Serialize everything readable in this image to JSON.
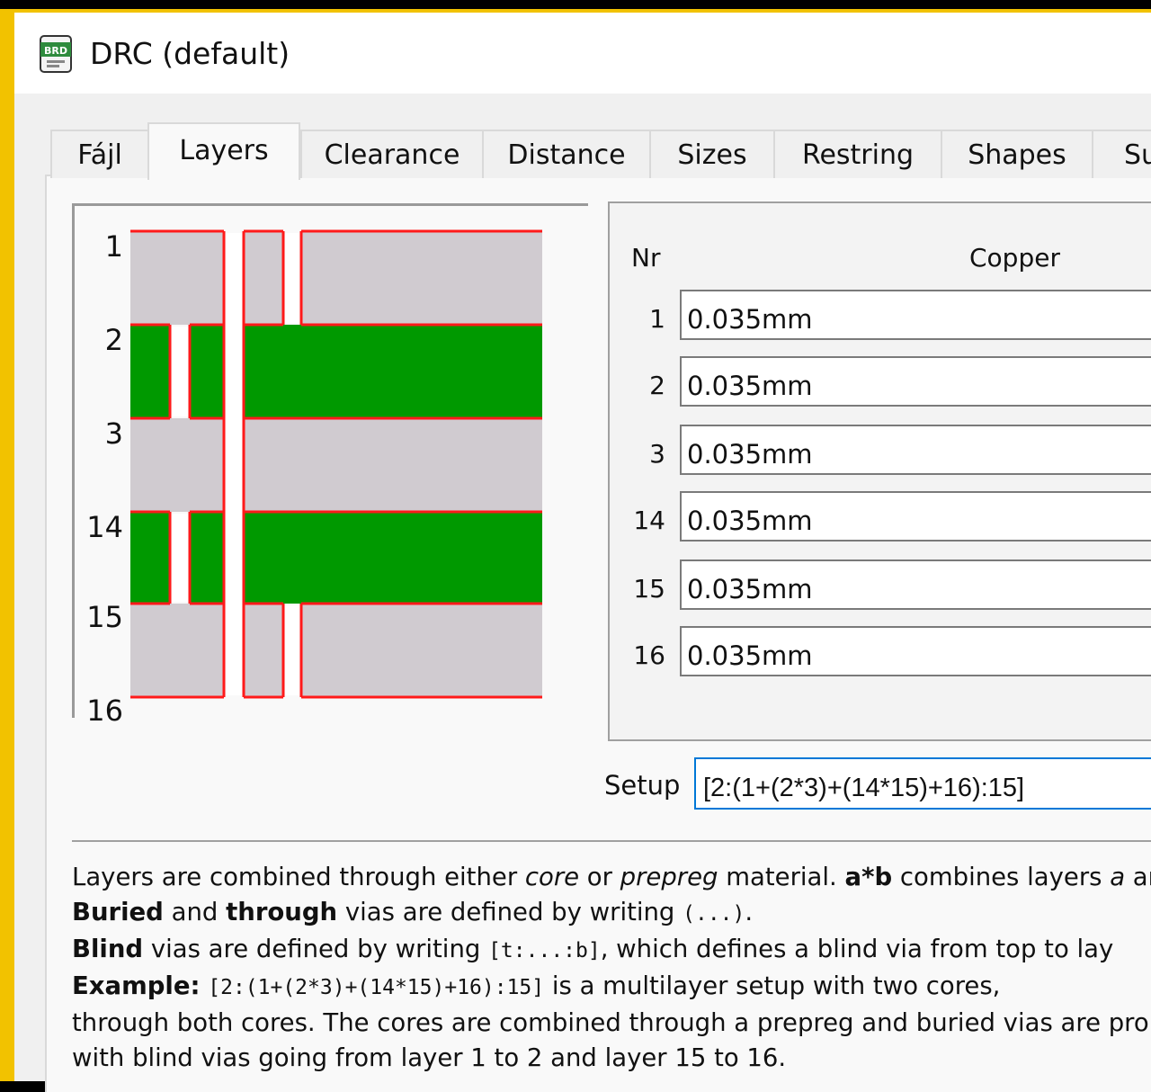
{
  "window": {
    "title": "DRC (default)",
    "icon": "brd-file-icon",
    "icon_text": "BRD"
  },
  "tabs": [
    {
      "label": "Fájl",
      "active": false
    },
    {
      "label": "Layers",
      "active": true
    },
    {
      "label": "Clearance",
      "active": false
    },
    {
      "label": "Distance",
      "active": false
    },
    {
      "label": "Sizes",
      "active": false
    },
    {
      "label": "Restring",
      "active": false
    },
    {
      "label": "Shapes",
      "active": false
    },
    {
      "label": "Su",
      "active": false
    }
  ],
  "diagram": {
    "layer_labels": [
      "1",
      "2",
      "3",
      "14",
      "15",
      "16"
    ],
    "colors": {
      "core": "#009900",
      "prepreg": "#d0cbd0",
      "via_outline": "#ff0000"
    }
  },
  "layers_table": {
    "headers": {
      "nr": "Nr",
      "copper": "Copper"
    },
    "rows": [
      {
        "nr": "1",
        "copper": "0.035mm"
      },
      {
        "nr": "2",
        "copper": "0.035mm"
      },
      {
        "nr": "3",
        "copper": "0.035mm"
      },
      {
        "nr": "14",
        "copper": "0.035mm"
      },
      {
        "nr": "15",
        "copper": "0.035mm"
      },
      {
        "nr": "16",
        "copper": "0.035mm"
      }
    ]
  },
  "setup": {
    "label": "Setup",
    "value": "[2:(1+(2*3)+(14*15)+16):15]"
  },
  "help": {
    "line1": {
      "a": "Layers are combined through either ",
      "core": "core",
      "b": " or ",
      "prepreg": "prepreg",
      "c": " material. ",
      "axb": "a*b",
      "d": " combines layers ",
      "a_var": "a",
      "e": " an"
    },
    "line2": {
      "buried": "Buried",
      "a": " and ",
      "through": "through",
      "b": " vias are defined by writing ",
      "code": "(...)",
      "c": "."
    },
    "line3": {
      "blind": "Blind",
      "a": " vias are defined by writing ",
      "code": "[t:...:b]",
      "b": ", which defines a blind via from top to lay"
    },
    "line4": {
      "example": "Example:",
      "code": "[2:(1+(2*3)+(14*15)+16):15]",
      "a": " is a multilayer setup with two cores,"
    },
    "line5": "through both cores. The cores are combined through a prepreg and buried vias are pro",
    "line6": "with blind vias going from layer 1 to 2 and layer 15 to 16."
  }
}
